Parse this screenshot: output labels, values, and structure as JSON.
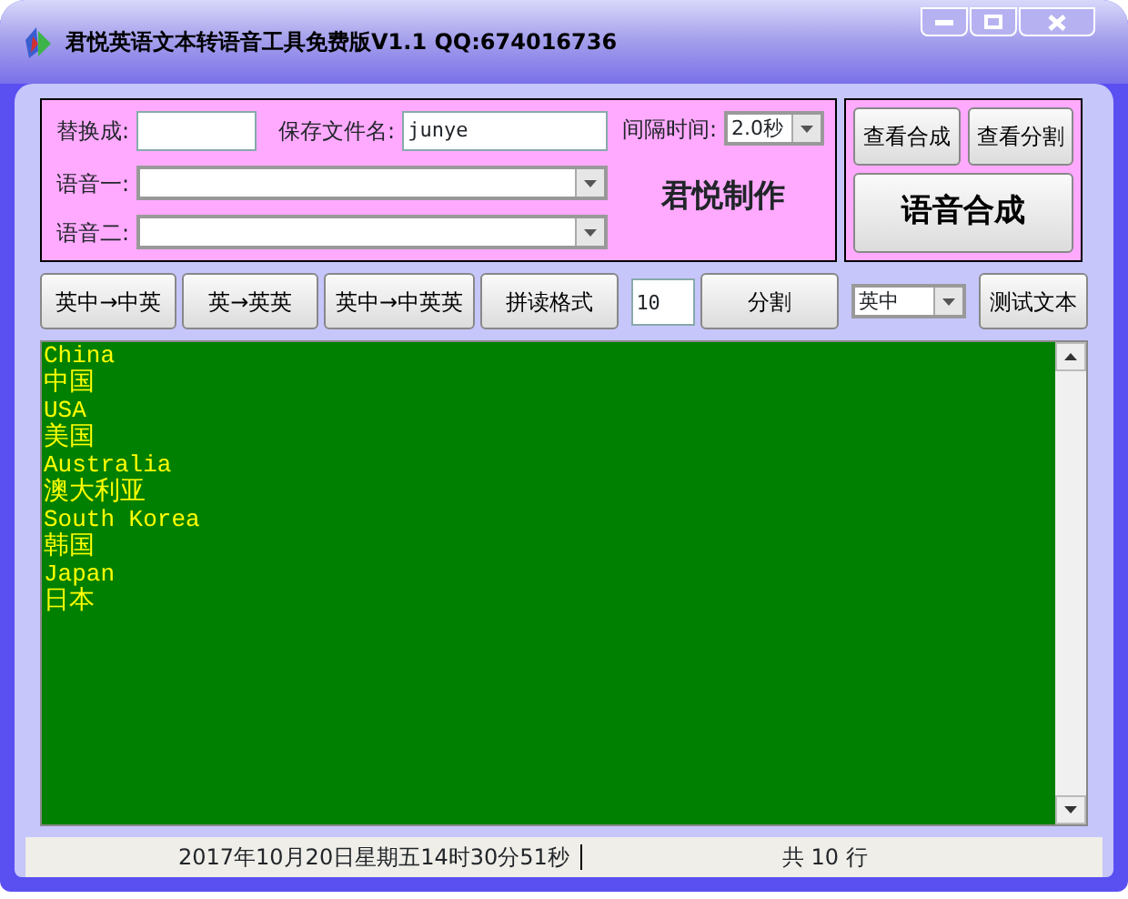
{
  "window": {
    "title": "君悦英语文本转语音工具免费版V1.1   QQ:674016736"
  },
  "form": {
    "replace_label": "替换成:",
    "filename_label": "保存文件名:",
    "filename_value": "junye",
    "interval_label": "间隔时间:",
    "interval_value": "2.0秒",
    "voice1_label": "语音一:",
    "voice2_label": "语音二:",
    "brand": "君悦制作"
  },
  "side_buttons": [
    "查看合成",
    "查看分割"
  ],
  "synth_button": "语音合成",
  "toolbar": {
    "buttons": [
      "英中→中英",
      "英→英英",
      "英中→中英英",
      "拼读格式"
    ],
    "split_count": "10",
    "split_button": "分割",
    "language": "英中",
    "test_button": "测试文本"
  },
  "text_lines": [
    {
      "text": "China",
      "kind": "latin"
    },
    {
      "text": "中国",
      "kind": "cjk"
    },
    {
      "text": "USA",
      "kind": "latin"
    },
    {
      "text": "美国",
      "kind": "cjk"
    },
    {
      "text": "Australia",
      "kind": "latin"
    },
    {
      "text": "澳大利亚",
      "kind": "cjk"
    },
    {
      "text": "South Korea",
      "kind": "latin"
    },
    {
      "text": "韩国",
      "kind": "cjk"
    },
    {
      "text": "Japan",
      "kind": "latin"
    },
    {
      "text": "日本",
      "kind": "cjk"
    }
  ],
  "status_bar": {
    "datetime": "2017年10月20日星期五14时30分51秒",
    "line_count": "共 10 行"
  }
}
